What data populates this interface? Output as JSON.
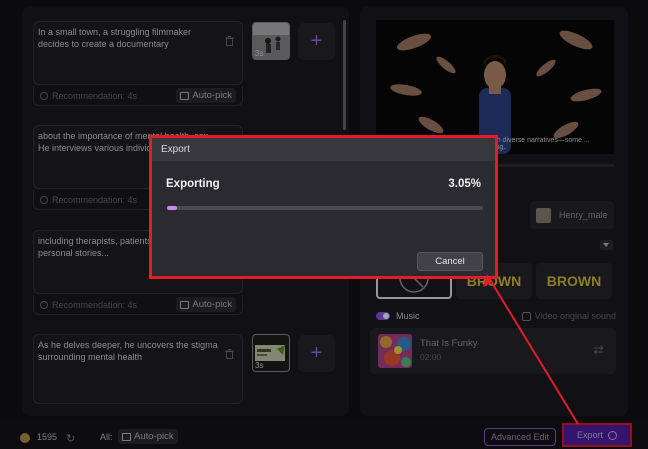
{
  "scenes": [
    {
      "text": "In a small town, a struggling filmmaker decides to create a documentary",
      "recommendation": "Recommendation: 4s",
      "autopick": "Auto-pick",
      "duration": "3s",
      "has_thumb": true
    },
    {
      "text": "about the importance of mental health, con... He interviews various individ...",
      "recommendation": "Recommendation: 4s",
      "autopick": "Auto-pick",
      "duration": "",
      "has_thumb": false
    },
    {
      "text": "including therapists, patients... sharing their personal stories...",
      "recommendation": "Recommendation: 4s",
      "autopick": "Auto-pick",
      "duration": "",
      "has_thumb": false
    },
    {
      "text": "As he delves deeper, he uncovers the stigma surrounding mental health",
      "recommendation": "",
      "autopick": "",
      "duration": "3s",
      "has_thumb": true
    }
  ],
  "preview": {
    "caption": "The filmmaker journeys through diverse narratives—some ... aking."
  },
  "voice": {
    "name": "Henry_male"
  },
  "styles": [
    {
      "label": ""
    },
    {
      "label": "BROWN"
    },
    {
      "label": "BROWN"
    }
  ],
  "music": {
    "label": "Music",
    "original_label": "Video original sound",
    "track_title": "That Is Funky",
    "track_time": "02:00"
  },
  "bottom": {
    "credits": "1595",
    "all_label": "All:",
    "autopick": "Auto-pick",
    "advanced_edit": "Advanced Edit",
    "export": "Export"
  },
  "dialog": {
    "title": "Export",
    "status": "Exporting",
    "percent_text": "3.05%",
    "progress": 0.0305,
    "cancel": "Cancel"
  },
  "colors": {
    "accent": "#8d57e8",
    "highlight": "#e11d2a",
    "progress": "#c58cf5"
  }
}
